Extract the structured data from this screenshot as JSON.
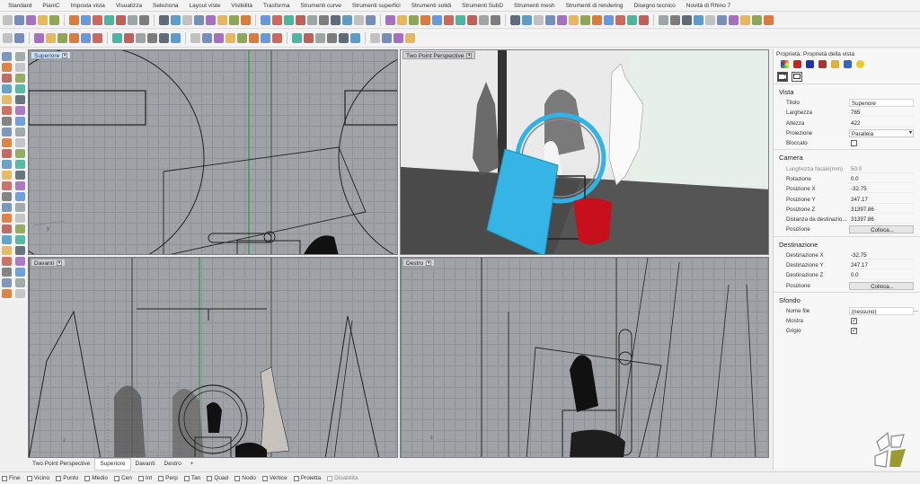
{
  "menu_tabs": [
    "Standard",
    "PianiC",
    "Imposta vista",
    "Visualizza",
    "Seleziona",
    "Layout viste",
    "Visibilità",
    "Trasforma",
    "Strumenti curve",
    "Strumenti superfici",
    "Strumenti solidi",
    "Strumenti SubD",
    "Strumenti mesh",
    "Strumenti di rendering",
    "Disegno tecnico",
    "Novità di Rhino 7"
  ],
  "viewports": {
    "top": {
      "label": "Superiore",
      "active": true
    },
    "perspective": {
      "label": "Two Point Perspective"
    },
    "front": {
      "label": "Davanti"
    },
    "right": {
      "label": "Destro"
    }
  },
  "viewport_tabs": [
    "Two Point Perspective",
    "Superiore",
    "Davanti",
    "Destro",
    "+"
  ],
  "viewport_tabs_active": "Superiore",
  "snaps": [
    {
      "label": "Fine",
      "disabled": false
    },
    {
      "label": "Vicino",
      "disabled": false
    },
    {
      "label": "Punto",
      "disabled": false
    },
    {
      "label": "Medio",
      "disabled": false
    },
    {
      "label": "Cen",
      "disabled": false
    },
    {
      "label": "Int",
      "disabled": false
    },
    {
      "label": "Perp",
      "disabled": false
    },
    {
      "label": "Tan",
      "disabled": false
    },
    {
      "label": "Quad",
      "disabled": false
    },
    {
      "label": "Nodo",
      "disabled": false
    },
    {
      "label": "Vertice",
      "disabled": false
    },
    {
      "label": "Proietta",
      "disabled": false
    },
    {
      "label": "Disabilita",
      "disabled": true
    }
  ],
  "properties": {
    "title": "Proprietà: Proprietà della vista",
    "sections": {
      "vista": {
        "heading": "Vista",
        "titolo_label": "Titolo",
        "titolo_value": "Superiore",
        "larghezza_label": "Larghezza",
        "larghezza_value": "765",
        "altezza_label": "Altezza",
        "altezza_value": "422",
        "proiezione_label": "Proiezione",
        "proiezione_value": "Parallela",
        "bloccato_label": "Bloccato"
      },
      "camera": {
        "heading": "Camera",
        "lunghezza_label": "Lunghezza focale(mm)",
        "lunghezza_value": "50.0",
        "rotazione_label": "Rotazione",
        "rotazione_value": "0.0",
        "posx_label": "Posizione X",
        "posx_value": "-32.75",
        "posy_label": "Posizione Y",
        "posy_value": "247.17",
        "posz_label": "Posizione Z",
        "posz_value": "31397.86",
        "distanza_label": "Distanza da destinazio...",
        "distanza_value": "31397.86",
        "posizione_label": "Posizione",
        "colloca_label": "Colloca..."
      },
      "destinazione": {
        "heading": "Destinazione",
        "dx_label": "Destinazione X",
        "dx_value": "-32.75",
        "dy_label": "Destinazione Y",
        "dy_value": "247.17",
        "dz_label": "Destinazione Z",
        "dz_value": "0.0",
        "posizione_label": "Posizione",
        "colloca_label": "Colloca..."
      },
      "sfondo": {
        "heading": "Sfondo",
        "nome_label": "Nome file",
        "nome_value": "(nessuno)",
        "more_label": "...",
        "mostra_label": "Mostra",
        "grigio_label": "Grigio"
      }
    }
  },
  "colors": {
    "viewport_bg": "#9fa2a6",
    "grid_green": "#2e9e3a",
    "sky_blue": "#2fb4e8",
    "cushion_red": "#c8101c",
    "logo_olive": "#8a8a2a"
  }
}
